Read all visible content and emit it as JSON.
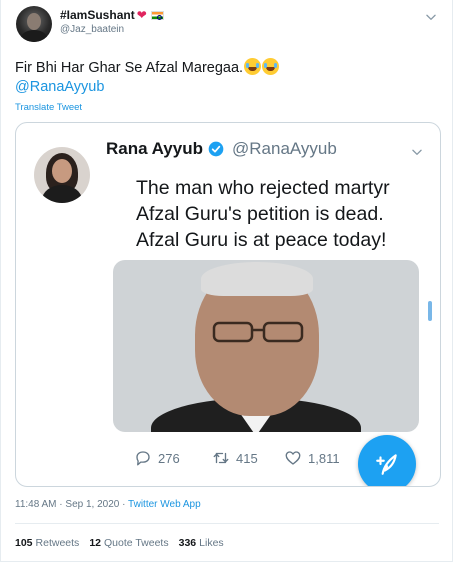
{
  "tweet": {
    "display_name": "#IamSushant",
    "handle": "@Jaz_baatein",
    "text": "Fir Bhi Har Ghar Se Afzal Maregaa.",
    "mention": "@RanaAyyub",
    "translate_label": "Translate Tweet",
    "emoji": [
      "face-with-tears-of-joy",
      "face-with-tears-of-joy"
    ]
  },
  "embedded": {
    "name": "Rana Ayyub",
    "handle": "@RanaAyyub",
    "text_lines": [
      "The man who rejected martyr",
      "Afzal Guru's petition is dead.",
      "Afzal Guru is at peace today!"
    ],
    "replies": "276",
    "retweets": "415",
    "likes": "1,811"
  },
  "meta": {
    "time": "11:48 AM · Sep 1, 2020 · ",
    "source": "Twitter Web App"
  },
  "stats": {
    "retweets_count": "105",
    "retweets_label": "Retweets",
    "quotes_count": "12",
    "quotes_label": "Quote Tweets",
    "likes_count": "336",
    "likes_label": "Likes"
  },
  "colors": {
    "accent": "#1da1f2",
    "link": "#1b95e0",
    "muted": "#657786",
    "heart": "#e0245e"
  },
  "icons": [
    "heart-emoji",
    "india-flag",
    "chevron-down-icon",
    "verified-badge-icon",
    "reply-icon",
    "retweet-icon",
    "like-icon",
    "compose-tweet-icon"
  ]
}
